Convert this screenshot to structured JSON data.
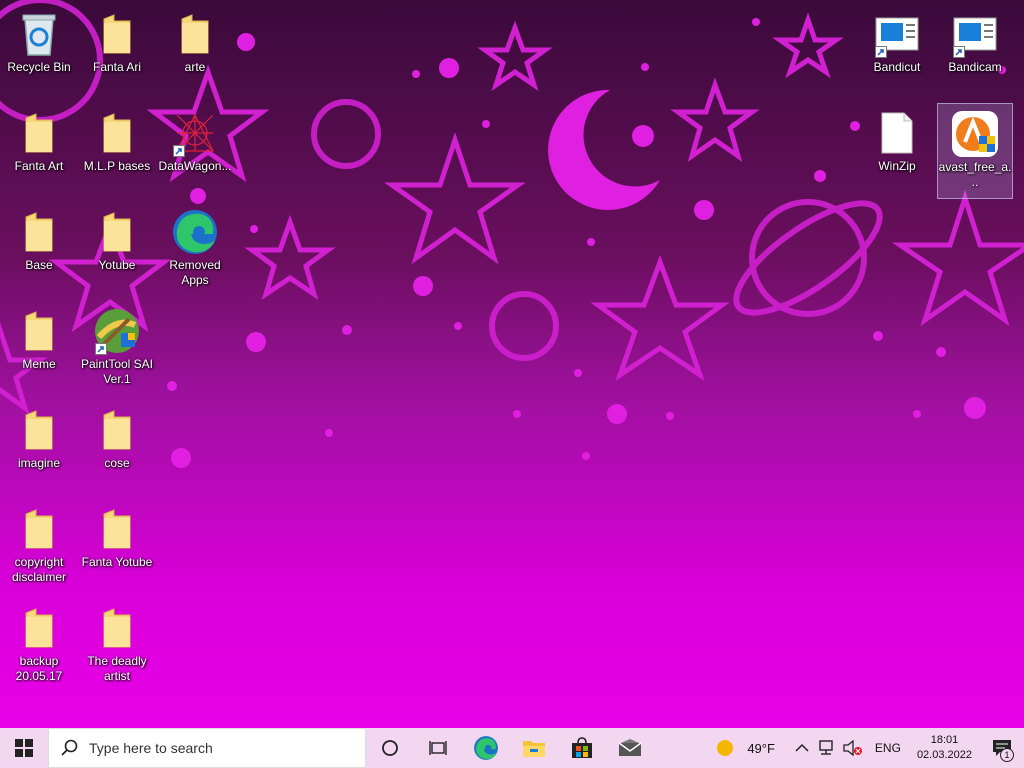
{
  "desktop_icons": [
    {
      "label": "Recycle Bin",
      "icon": "recycle-bin-icon"
    },
    {
      "label": "Fanta Ari",
      "icon": "folder-icon"
    },
    {
      "label": "arte",
      "icon": "folder-icon"
    },
    {
      "label": "Fanta Art",
      "icon": "folder-icon"
    },
    {
      "label": "M.L.P bases",
      "icon": "folder-icon"
    },
    {
      "label": "DataWagon...",
      "icon": "datawagon-icon"
    },
    {
      "label": "Base",
      "icon": "folder-icon"
    },
    {
      "label": "Yotube",
      "icon": "folder-icon"
    },
    {
      "label": "Removed Apps",
      "icon": "edge-icon"
    },
    {
      "label": "Meme",
      "icon": "folder-icon"
    },
    {
      "label": "PaintTool SAI Ver.1",
      "icon": "painttool-sai-icon"
    },
    {
      "label": "imagine",
      "icon": "folder-icon"
    },
    {
      "label": "cose",
      "icon": "folder-icon"
    },
    {
      "label": "copyright disclaimer",
      "icon": "folder-icon"
    },
    {
      "label": "Fanta Yotube",
      "icon": "folder-icon"
    },
    {
      "label": "backup 20.05.17",
      "icon": "folder-icon"
    },
    {
      "label": "The deadly artist",
      "icon": "folder-icon"
    },
    {
      "label": "Bandicut",
      "icon": "bandicut-icon"
    },
    {
      "label": "Bandicam",
      "icon": "bandicam-icon"
    },
    {
      "label": "WinZip",
      "icon": "file-icon"
    },
    {
      "label": "avast_free_a...",
      "icon": "avast-icon"
    }
  ],
  "taskbar": {
    "search_placeholder": "Type here to search",
    "weather_temp": "49°F",
    "language": "ENG",
    "time": "18:01",
    "date": "02.03.2022",
    "notification_count": "1"
  },
  "colors": {
    "taskbar_bg": "#f3d6f0",
    "wallpaper_accent": "#e020e0",
    "folder": "#f6d77a"
  }
}
